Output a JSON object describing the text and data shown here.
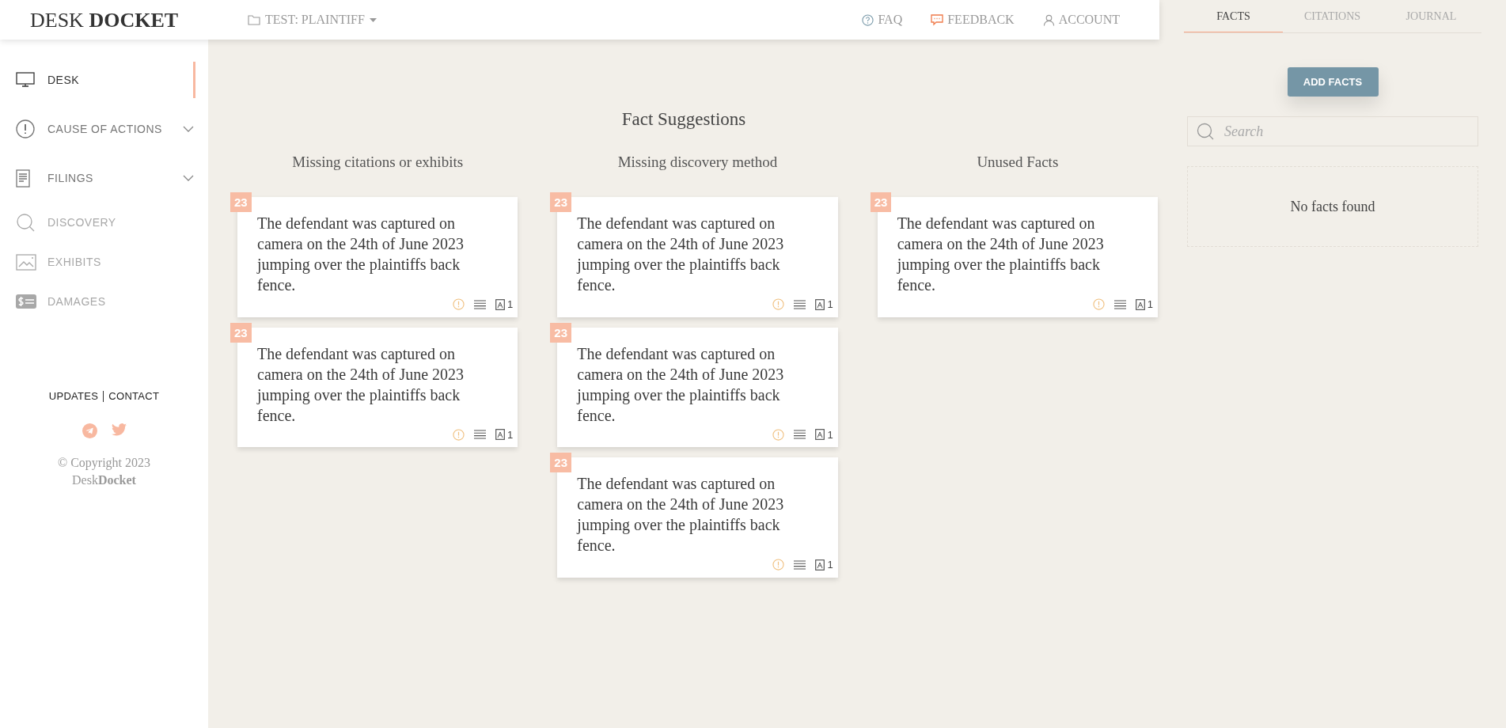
{
  "header": {
    "logo": {
      "light": "DESK",
      "bold": "DOCKET"
    },
    "case_selector": "TEST: PLAINTIFF",
    "links": [
      {
        "kind": "faq",
        "label": "FAQ"
      },
      {
        "kind": "feedback",
        "label": "FEEDBACK"
      },
      {
        "kind": "account",
        "label": "ACCOUNT"
      }
    ]
  },
  "sidebar": {
    "items": [
      {
        "kind": "monitor",
        "label": "DESK",
        "selected": true,
        "disabled": false,
        "expandable": false
      },
      {
        "kind": "alert",
        "label": "CAUSE OF ACTIONS",
        "selected": false,
        "disabled": false,
        "expandable": true
      },
      {
        "kind": "document",
        "label": "FILINGS",
        "selected": false,
        "disabled": false,
        "expandable": true
      },
      {
        "kind": "search",
        "label": "DISCOVERY",
        "selected": false,
        "disabled": true,
        "expandable": false
      },
      {
        "kind": "image",
        "label": "EXHIBITS",
        "selected": false,
        "disabled": true,
        "expandable": false
      },
      {
        "kind": "money",
        "label": "DAMAGES",
        "selected": false,
        "disabled": true,
        "expandable": false
      }
    ],
    "footer": {
      "links": [
        "UPDATES",
        "CONTACT"
      ],
      "copyright": "© Copyright 2023",
      "brand": "Desk**Docket**"
    }
  },
  "main": {
    "title": "Fact Suggestions",
    "columns": [
      {
        "heading": "Missing citations or exhibits",
        "cards": [
          {
            "number": "23",
            "text": "The defendant was captured on camera on the 24th of June 2023 jumping over the plaintiffs back fence.",
            "exhibit_count": "1"
          },
          {
            "number": "23",
            "text": "The defendant was captured on camera on the 24th of June 2023 jumping over the plaintiffs back fence.",
            "exhibit_count": "1"
          }
        ]
      },
      {
        "heading": "Missing discovery method",
        "cards": [
          {
            "number": "23",
            "text": "The defendant was captured on camera on the 24th of June 2023 jumping over the plaintiffs back fence.",
            "exhibit_count": "1"
          },
          {
            "number": "23",
            "text": "The defendant was captured on camera on the 24th of June 2023 jumping over the plaintiffs back fence.",
            "exhibit_count": "1"
          },
          {
            "number": "23",
            "text": "The defendant was captured on camera on the 24th of June 2023 jumping over the plaintiffs back fence.",
            "exhibit_count": "1"
          }
        ]
      },
      {
        "heading": "Unused Facts",
        "cards": [
          {
            "number": "23",
            "text": "The defendant was captured on camera on the 24th of June 2023 jumping over the plaintiffs back fence.",
            "exhibit_count": "1"
          }
        ]
      }
    ]
  },
  "right_panel": {
    "tabs": [
      {
        "label": "FACTS",
        "selected": true
      },
      {
        "label": "CITATIONS",
        "selected": false
      },
      {
        "label": "JOURNAL",
        "selected": false
      }
    ],
    "add_button": "ADD FACTS",
    "search": {
      "placeholder": "Search"
    },
    "empty_message": "No facts found"
  }
}
